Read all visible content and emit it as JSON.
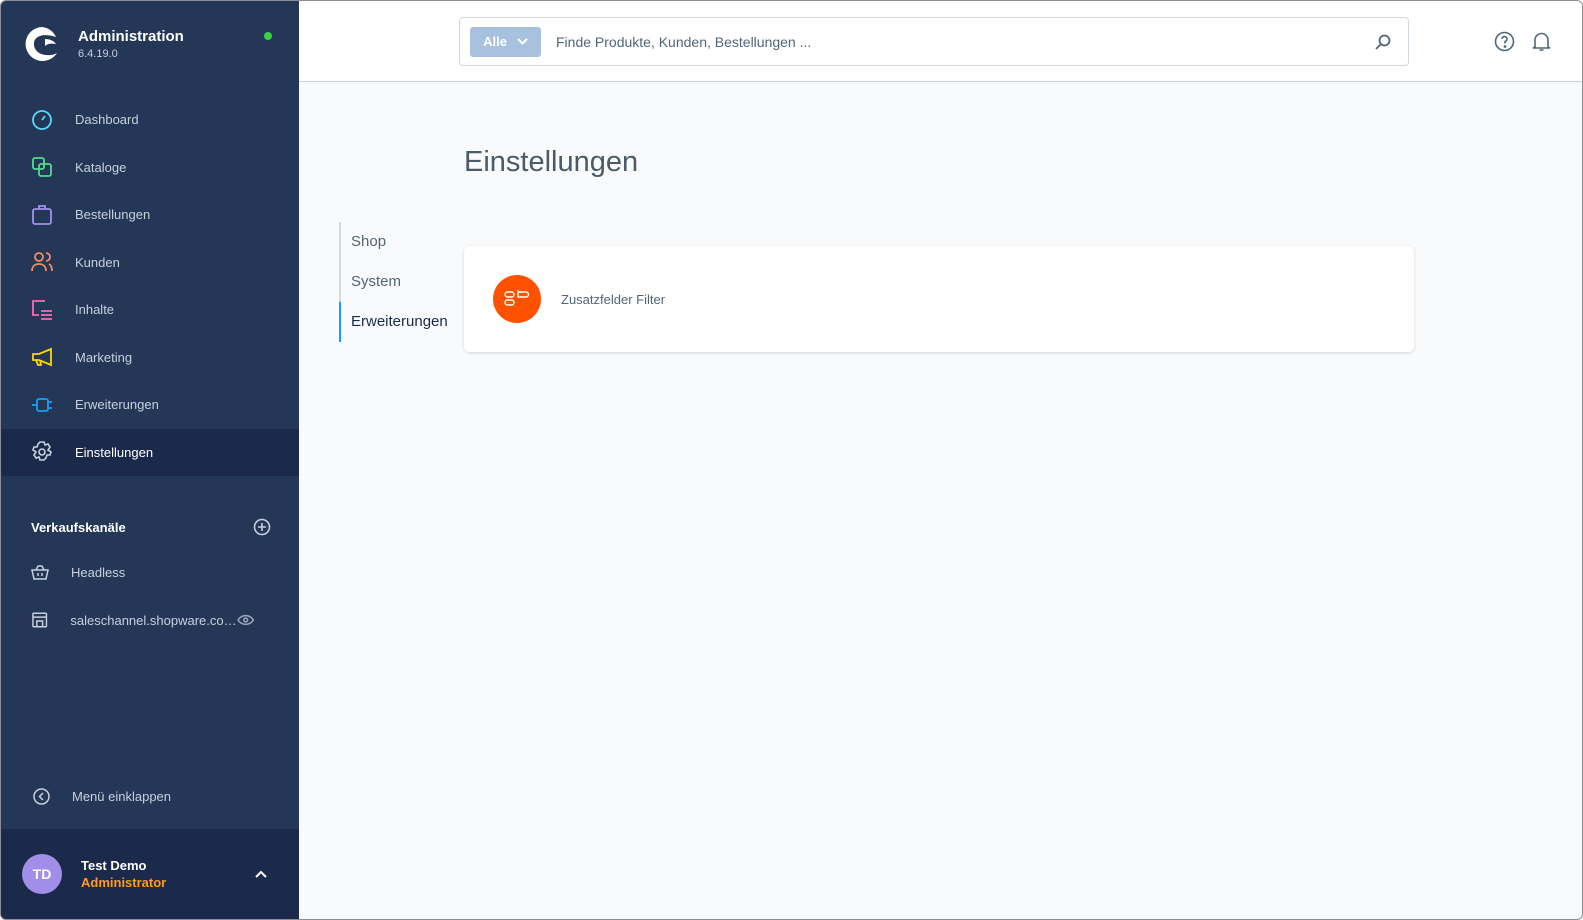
{
  "app": {
    "title": "Administration",
    "version": "6.4.19.0",
    "status_color": "#37d046"
  },
  "sidebar": {
    "items": [
      {
        "label": "Dashboard",
        "icon": "dashboard-icon",
        "color": "#57d9f8"
      },
      {
        "label": "Kataloge",
        "icon": "catalog-icon",
        "color": "#57d98f"
      },
      {
        "label": "Bestellungen",
        "icon": "shopping-bag-icon",
        "color": "#a092f0"
      },
      {
        "label": "Kunden",
        "icon": "users-icon",
        "color": "#f88962"
      },
      {
        "label": "Inhalte",
        "icon": "content-icon",
        "color": "#ff68b4"
      },
      {
        "label": "Marketing",
        "icon": "megaphone-icon",
        "color": "#ffd700"
      },
      {
        "label": "Erweiterungen",
        "icon": "plug-icon",
        "color": "#189eff"
      },
      {
        "label": "Einstellungen",
        "icon": "gear-icon",
        "color": "#c7d1de",
        "active": true
      }
    ],
    "sales_channels": {
      "title": "Verkaufskanäle",
      "items": [
        {
          "label": "Headless",
          "icon": "basket-icon"
        },
        {
          "label": "saleschannel.shopware.co…",
          "icon": "storefront-icon"
        }
      ]
    },
    "collapse_label": "Menü einklappen",
    "user": {
      "initials": "TD",
      "name": "Test Demo",
      "role": "Administrator"
    }
  },
  "header": {
    "search": {
      "type": "Alle",
      "placeholder": "Finde Produkte, Kunden, Bestellungen ..."
    }
  },
  "main": {
    "title": "Einstellungen",
    "tabs": [
      {
        "label": "Shop"
      },
      {
        "label": "System"
      },
      {
        "label": "Erweiterungen",
        "active": true
      }
    ],
    "extensions": [
      {
        "name": "Zusatzfelder Filter",
        "logo_color": "#ff5100"
      }
    ]
  }
}
